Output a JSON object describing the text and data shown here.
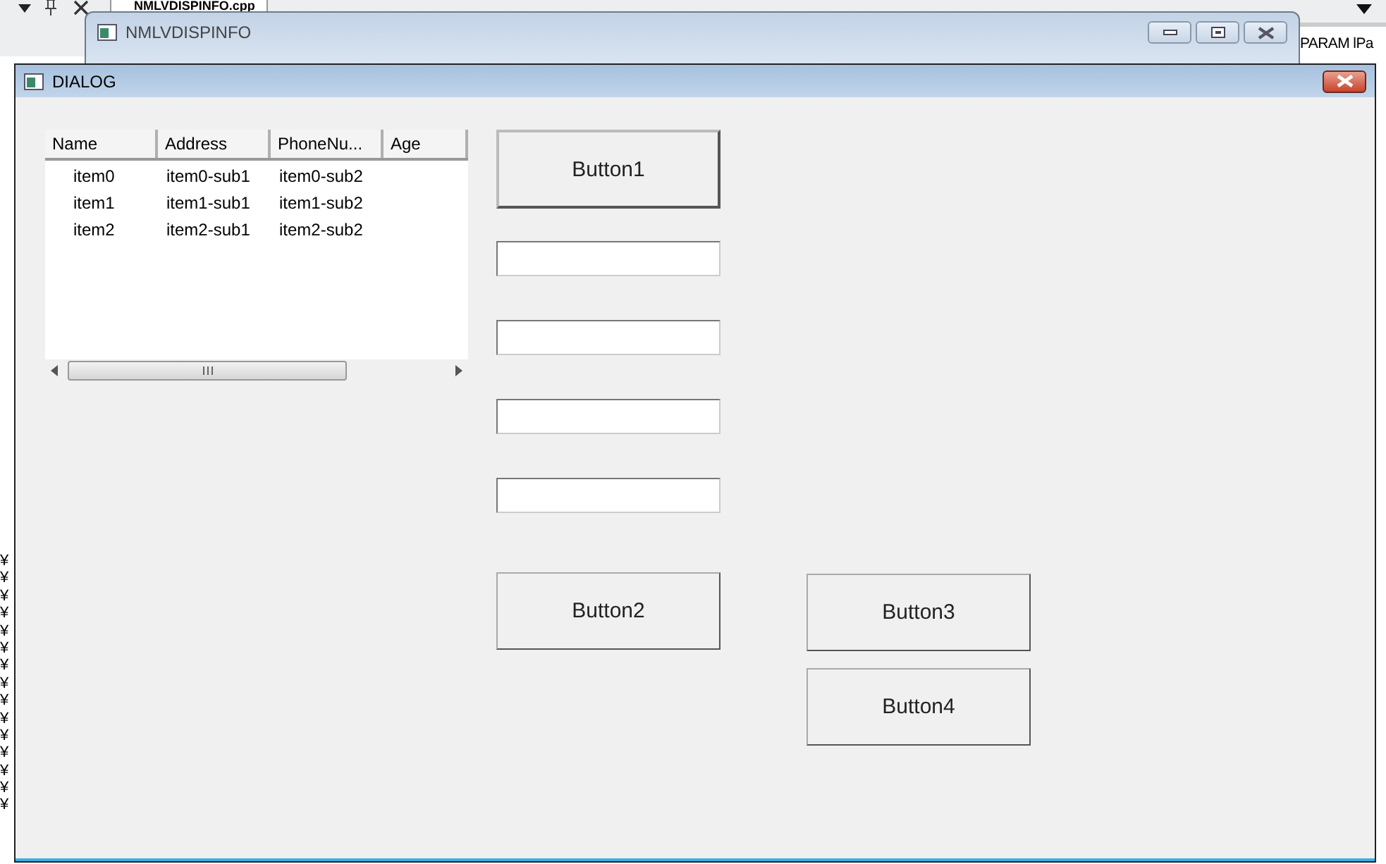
{
  "background_ide": {
    "tab_title": "NMLVDISPINFO.cpp",
    "code_fragment": "PARAM lPa",
    "left_fragments": [
      "¥",
      "¥",
      "¥",
      "¥",
      "¥",
      "¥",
      "¥",
      "¥",
      "¥",
      "¥",
      "¥",
      "¥",
      "¥",
      "¥",
      "¥"
    ]
  },
  "back_window": {
    "title": "NMLVDISPINFO"
  },
  "dialog": {
    "title": "DIALOG",
    "list_view": {
      "columns": [
        "Name",
        "Address",
        "PhoneNu...",
        "Age"
      ],
      "rows": [
        [
          "item0",
          "item0-sub1",
          "item0-sub2"
        ],
        [
          "item1",
          "item1-sub1",
          "item1-sub2"
        ],
        [
          "item2",
          "item2-sub1",
          "item2-sub2"
        ]
      ]
    },
    "buttons": [
      "Button1",
      "Button2",
      "Button3",
      "Button4"
    ],
    "edit_fields": [
      {
        "kind": "textbox"
      },
      {
        "kind": "textbox"
      },
      {
        "kind": "textbox"
      },
      {
        "kind": "textbox"
      }
    ]
  }
}
